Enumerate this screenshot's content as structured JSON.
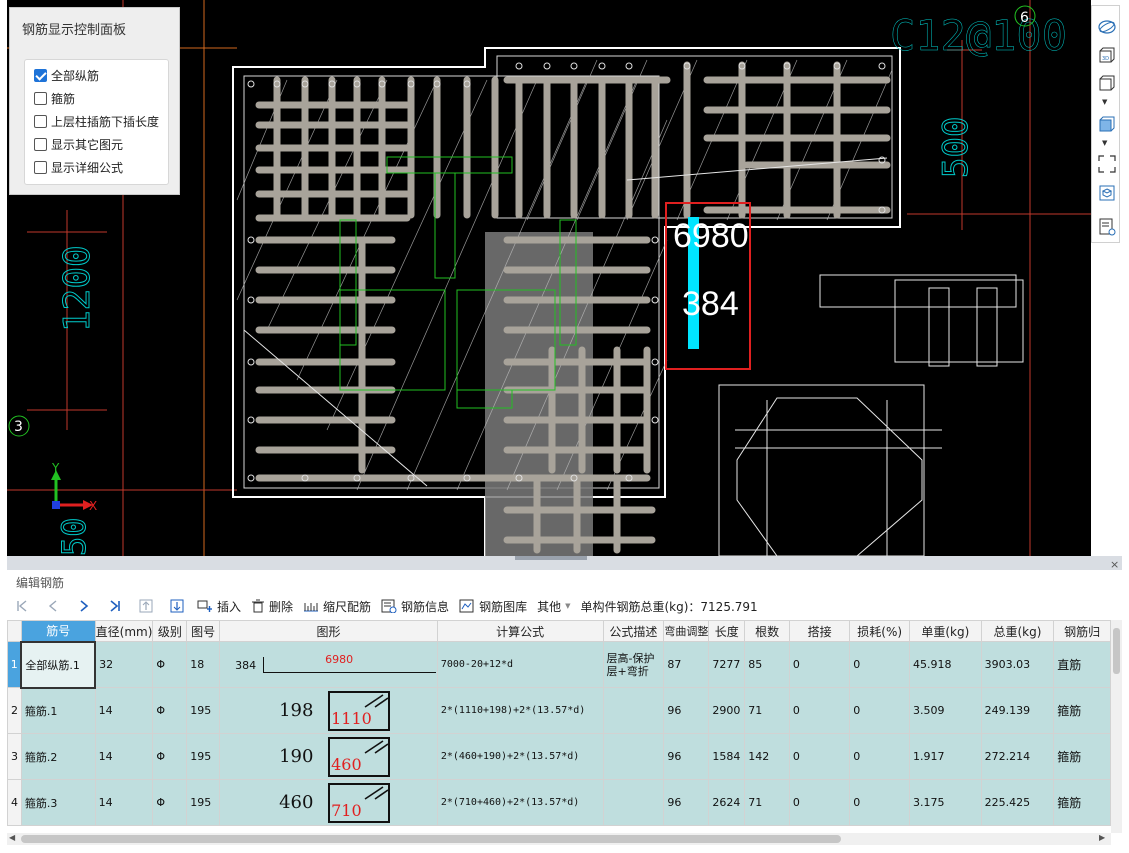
{
  "control_panel": {
    "title": "钢筋显示控制面板",
    "options": [
      {
        "label": "全部纵筋",
        "checked": true
      },
      {
        "label": "箍筋",
        "checked": false
      },
      {
        "label": "上层柱插筋下插长度",
        "checked": false
      },
      {
        "label": "显示其它图元",
        "checked": false
      },
      {
        "label": "显示详细公式",
        "checked": false
      }
    ]
  },
  "viewport": {
    "axis_label_top": "C12@100",
    "axis_number_6": "6",
    "axis_number_3": "3",
    "dim_500": "500",
    "dim_1200": "1200",
    "dim_bottom": "50",
    "highlight_length": "6980",
    "highlight_bend": "384",
    "axis_y": "Y",
    "axis_x": "X",
    "accent_color": "#00e5ff",
    "highlight_color": "#e02020"
  },
  "right_toolbar": {
    "icons": [
      "sphere-view-icon",
      "3d-view-icon",
      "cube-view-icon",
      "box-select-icon",
      "fullscreen-icon",
      "layer-icon",
      "list-view-icon"
    ]
  },
  "edit_panel": {
    "title": "编辑钢筋",
    "close": "×",
    "toolbar": {
      "insert": "插入",
      "delete": "删除",
      "scale": "缩尺配筋",
      "info": "钢筋信息",
      "library": "钢筋图库",
      "other": "其他",
      "total_label": "单构件钢筋总重(kg)：7125.791"
    },
    "columns": [
      "筋号",
      "直径(mm)",
      "级别",
      "图号",
      "图形",
      "计算公式",
      "公式描述",
      "弯曲调整",
      "长度",
      "根数",
      "搭接",
      "损耗(%)",
      "单重(kg)",
      "总重(kg)",
      "钢筋归"
    ],
    "rows": [
      {
        "num": "1",
        "name": "全部纵筋.1",
        "dia": "32",
        "grade": "Φ",
        "fig": "18",
        "shape_left": "384",
        "shape_main": "6980",
        "formula": "7000-20+12*d",
        "desc": "层高-保护层+弯折",
        "bend": "87",
        "len": "7277",
        "count": "85",
        "lap": "0",
        "loss": "0",
        "unit": "45.918",
        "total": "3903.03",
        "type": "直筋"
      },
      {
        "num": "2",
        "name": "箍筋.1",
        "dia": "14",
        "grade": "Φ",
        "fig": "195",
        "shape_left": "198",
        "shape_main": "1110",
        "formula": "2*(1110+198)+2*(13.57*d)",
        "desc": "",
        "bend": "96",
        "len": "2900",
        "count": "71",
        "lap": "0",
        "loss": "0",
        "unit": "3.509",
        "total": "249.139",
        "type": "箍筋"
      },
      {
        "num": "3",
        "name": "箍筋.2",
        "dia": "14",
        "grade": "Φ",
        "fig": "195",
        "shape_left": "190",
        "shape_main": "460",
        "formula": "2*(460+190)+2*(13.57*d)",
        "desc": "",
        "bend": "96",
        "len": "1584",
        "count": "142",
        "lap": "0",
        "loss": "0",
        "unit": "1.917",
        "total": "272.214",
        "type": "箍筋"
      },
      {
        "num": "4",
        "name": "箍筋.3",
        "dia": "14",
        "grade": "Φ",
        "fig": "195",
        "shape_left": "460",
        "shape_main": "710",
        "formula": "2*(710+460)+2*(13.57*d)",
        "desc": "",
        "bend": "96",
        "len": "2624",
        "count": "71",
        "lap": "0",
        "loss": "0",
        "unit": "3.175",
        "total": "225.425",
        "type": "箍筋"
      }
    ]
  }
}
